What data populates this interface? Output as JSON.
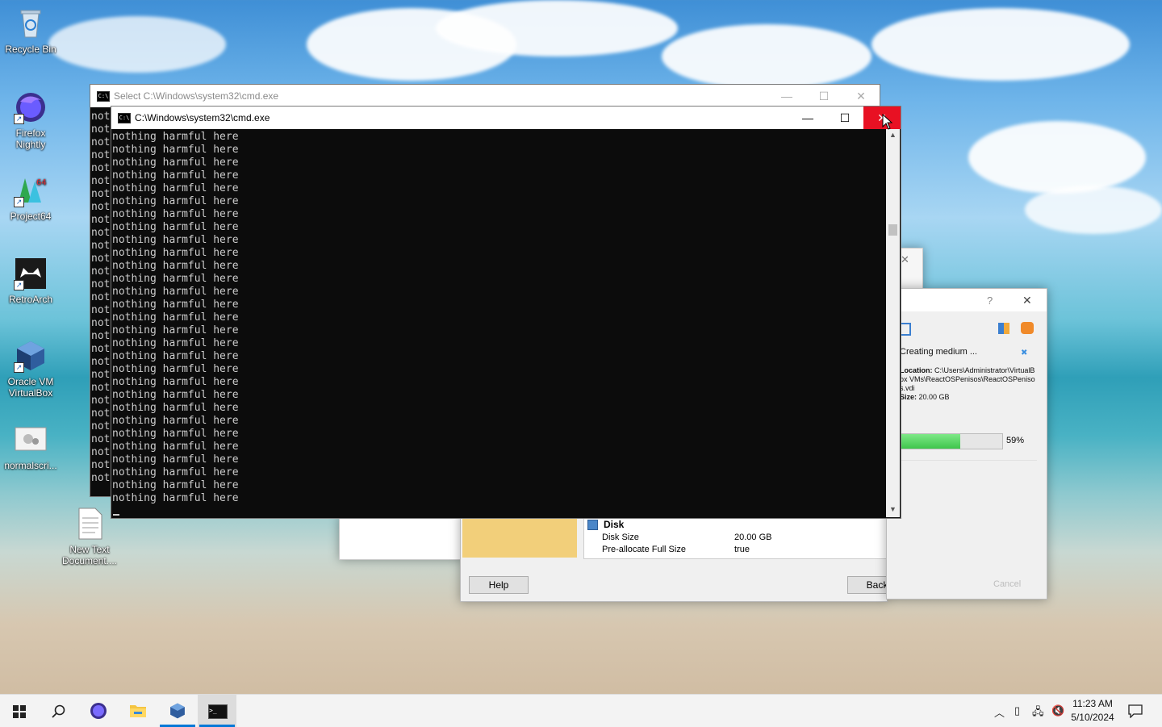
{
  "desktop": {
    "icons": [
      {
        "label": "Recycle Bin",
        "icon": "recycle-bin-icon"
      },
      {
        "label": "Firefox Nightly",
        "icon": "firefox-nightly-icon"
      },
      {
        "label": "Project64",
        "icon": "project64-icon"
      },
      {
        "label": "RetroArch",
        "icon": "retroarch-icon"
      },
      {
        "label": "Oracle VM VirtualBox",
        "icon": "virtualbox-icon"
      },
      {
        "label": "normalscri...",
        "icon": "script-file-icon"
      },
      {
        "label": "New Text Document....",
        "icon": "text-document-icon"
      }
    ]
  },
  "cmd_back": {
    "title": "Select C:\\Windows\\system32\\cmd.exe",
    "line_fragment": "not"
  },
  "cmd_front": {
    "title": "C:\\Windows\\system32\\cmd.exe",
    "line_text": "nothing harmful here",
    "line_count": 29
  },
  "vbox_dialog": {
    "section_title": "Disk",
    "rows": [
      {
        "label": "Disk Size",
        "value": "20.00 GB"
      },
      {
        "label": "Pre-allocate Full Size",
        "value": "true"
      }
    ],
    "help_label": "Help",
    "back_label": "Back"
  },
  "progress_window": {
    "help_glyph": "?",
    "close_glyph": "✕",
    "task_title": "Creating medium ...",
    "location_label": "Location:",
    "location_value": "C:\\Users\\Administrator\\VirtualBox VMs\\ReactOSPenisos\\ReactOSPenisos.vdi",
    "size_label": "Size:",
    "size_value": "20.00 GB",
    "progress_percent": 59,
    "progress_text": "59%",
    "cancel_label": "Cancel"
  },
  "taskbar": {
    "time": "11:23 AM",
    "date": "5/10/2024",
    "items": [
      "start-button",
      "search-button",
      "firefox-nightly",
      "file-explorer",
      "virtualbox",
      "command-prompt"
    ]
  },
  "colors": {
    "close_hover": "#e81123",
    "progress_fill": "#4cd964",
    "accent": "#0078d7"
  }
}
